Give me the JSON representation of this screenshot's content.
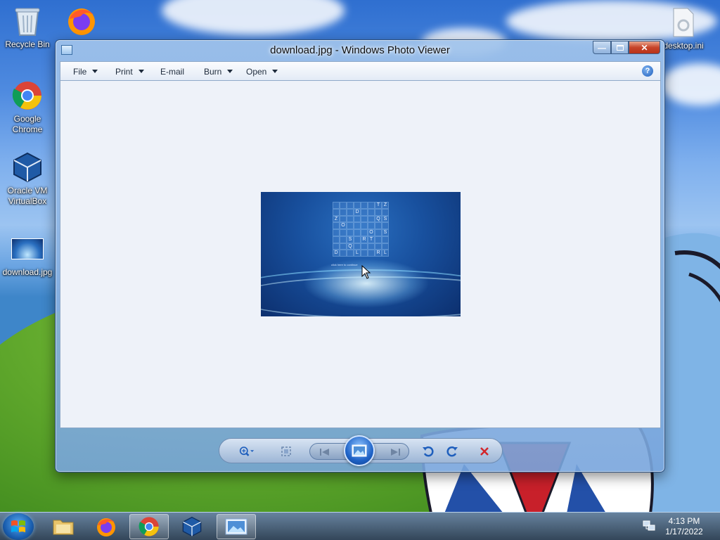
{
  "desktop": {
    "icons": [
      {
        "label": "Recycle Bin",
        "icon": "recycle-bin-icon"
      },
      {
        "label": "Google Chrome",
        "icon": "chrome-icon"
      },
      {
        "label": "Oracle VM VirtualBox",
        "icon": "virtualbox-icon"
      },
      {
        "label": "download.jpg",
        "icon": "image-file-icon"
      },
      {
        "label": "desktop.ini",
        "icon": "ini-file-icon"
      }
    ]
  },
  "window": {
    "title": "download.jpg - Windows Photo Viewer",
    "menu": [
      {
        "label": "File",
        "has_dropdown": true
      },
      {
        "label": "Print",
        "has_dropdown": true
      },
      {
        "label": "E-mail",
        "has_dropdown": false
      },
      {
        "label": "Burn",
        "has_dropdown": true
      },
      {
        "label": "Open",
        "has_dropdown": true
      }
    ],
    "help_icon": "help-icon",
    "photo": {
      "grid_letters": [
        "",
        "",
        "",
        "",
        "",
        "",
        "T",
        "Z",
        "",
        "",
        "",
        "D",
        "",
        "",
        "",
        "",
        "Z",
        "",
        "",
        "",
        "",
        "",
        "Q",
        "S",
        "",
        "O",
        "",
        "",
        "",
        "",
        "",
        "",
        "",
        "",
        "",
        "",
        "",
        "O",
        "",
        "S",
        "",
        "",
        "S",
        "",
        "R",
        "T",
        "",
        "",
        "",
        "",
        "Q",
        "",
        "",
        "",
        "",
        "",
        "D",
        "",
        "",
        "L",
        "",
        "",
        "R",
        "L"
      ],
      "caption": "click here to continue"
    },
    "controls": {
      "zoom": "zoom-icon",
      "actual_size": "actual-size-icon",
      "previous": "previous-icon",
      "slideshow": "slideshow-icon",
      "next": "next-icon",
      "rotate_ccw": "rotate-counterclockwise-icon",
      "rotate_cw": "rotate-clockwise-icon",
      "delete": "delete-icon"
    }
  },
  "taskbar": {
    "items": [
      {
        "name": "explorer",
        "icon": "folder-icon",
        "active": false
      },
      {
        "name": "firefox",
        "icon": "firefox-icon",
        "active": false
      },
      {
        "name": "chrome",
        "icon": "chrome-icon",
        "active": true
      },
      {
        "name": "virtualbox",
        "icon": "virtualbox-icon",
        "active": false
      },
      {
        "name": "photo-viewer",
        "icon": "photo-viewer-icon",
        "active": true
      }
    ],
    "clock": {
      "time": "4:13 PM",
      "date": "1/17/2022"
    }
  },
  "colors": {
    "accent": "#1f63c7",
    "close": "#c7452a",
    "viewport_bg": "#eef2f9"
  }
}
